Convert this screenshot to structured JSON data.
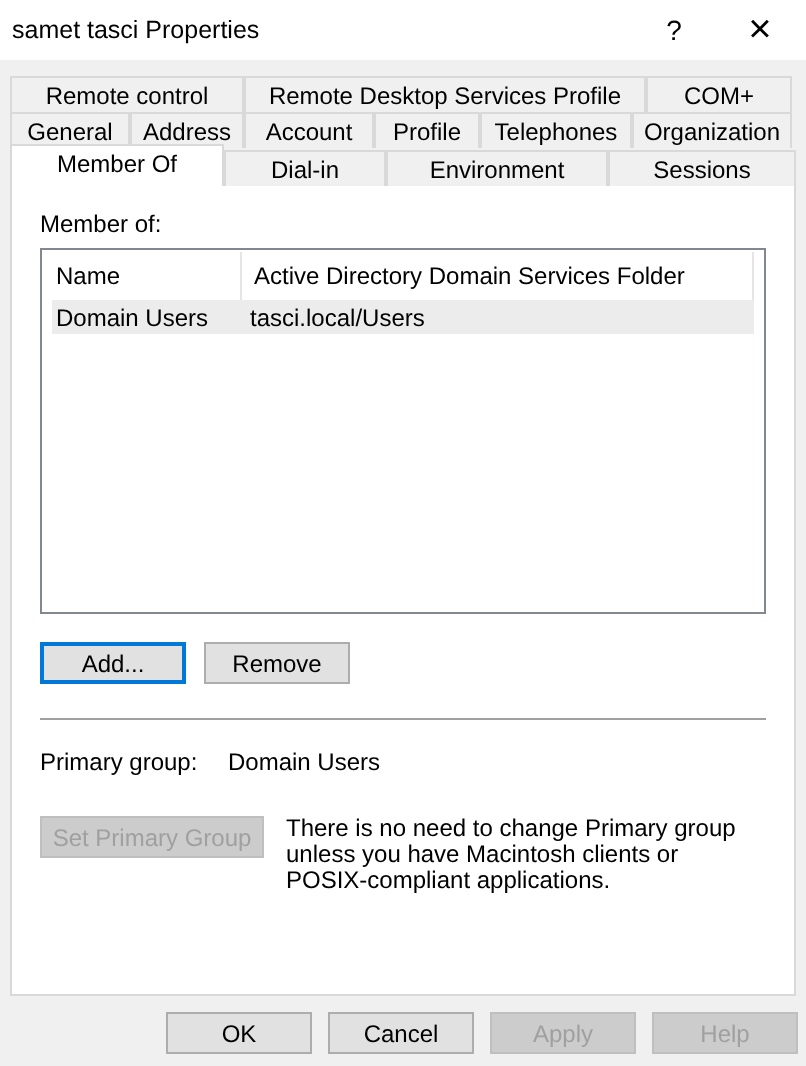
{
  "window": {
    "title": "samet tasci Properties",
    "help": "?",
    "close": "×"
  },
  "tab_rows": [
    [
      {
        "label": "Remote control",
        "selected": false
      },
      {
        "label": "Remote Desktop Services Profile",
        "selected": false
      },
      {
        "label": "COM+",
        "selected": false
      }
    ],
    [
      {
        "label": "General",
        "selected": false
      },
      {
        "label": "Address",
        "selected": false
      },
      {
        "label": "Account",
        "selected": false
      },
      {
        "label": "Profile",
        "selected": false
      },
      {
        "label": "Telephones",
        "selected": false
      },
      {
        "label": "Organization",
        "selected": false
      }
    ],
    [
      {
        "label": "Member Of",
        "selected": true
      },
      {
        "label": "Dial-in",
        "selected": false
      },
      {
        "label": "Environment",
        "selected": false
      },
      {
        "label": "Sessions",
        "selected": false
      }
    ]
  ],
  "member_of": {
    "label": "Member of:",
    "columns": [
      "Name",
      "Active Directory Domain Services Folder"
    ],
    "rows": [
      {
        "cells": [
          "Domain Users",
          "tasci.local/Users"
        ],
        "selected": true
      }
    ]
  },
  "list_buttons": [
    {
      "label": "Add...",
      "focused": true,
      "disabled": false
    },
    {
      "label": "Remove",
      "focused": false,
      "disabled": false
    }
  ],
  "primary_group": {
    "label": "Primary group:",
    "value": "Domain Users"
  },
  "set_primary_button": {
    "label": "Set Primary Group",
    "disabled": true
  },
  "note": "There is no need to change Primary group unless you have Macintosh clients or POSIX-compliant applications.",
  "dialog_buttons": [
    {
      "label": "OK",
      "disabled": false
    },
    {
      "label": "Cancel",
      "disabled": false
    },
    {
      "label": "Apply",
      "disabled": true
    },
    {
      "label": "Help",
      "disabled": true
    }
  ]
}
